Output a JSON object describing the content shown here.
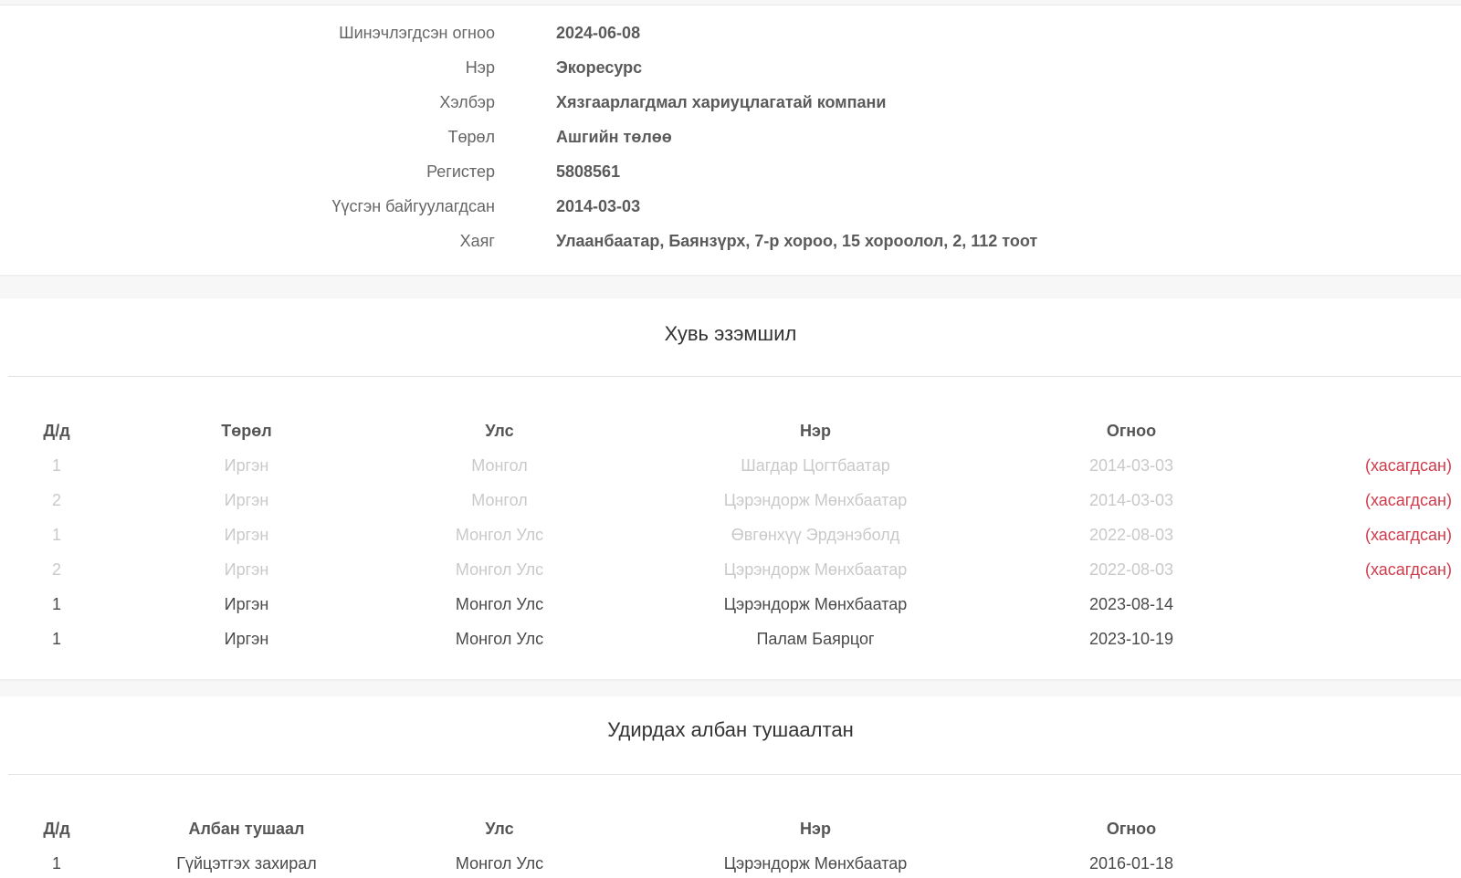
{
  "company_info": {
    "rows": [
      {
        "label": "Шинэчлэгдсэн огноо",
        "value": "2024-06-08"
      },
      {
        "label": "Нэр",
        "value": "Экоресурс"
      },
      {
        "label": "Хэлбэр",
        "value": "Хязгаарлагдмал хариуцлагатай компани"
      },
      {
        "label": "Төрөл",
        "value": "Ашгийн төлөө"
      },
      {
        "label": "Регистер",
        "value": "5808561"
      },
      {
        "label": "Үүсгэн байгуулагдсан",
        "value": "2014-03-03"
      },
      {
        "label": "Хаяг",
        "value": "Улаанбаатар, Баянзүрх, 7-р хороо, 15 хороолол, 2, 112 тоот"
      }
    ]
  },
  "ownership": {
    "title": "Хувь эзэмшил",
    "headers": [
      "Д/д",
      "Төрөл",
      "Улс",
      "Нэр",
      "Огноо"
    ],
    "rows": [
      {
        "no": "1",
        "type": "Иргэн",
        "country": "Монгол",
        "name": "Шагдар Цогтбаатар",
        "date": "2014-03-03",
        "status": "(хасагдсан)"
      },
      {
        "no": "2",
        "type": "Иргэн",
        "country": "Монгол",
        "name": "Цэрэндорж Мөнхбаатар",
        "date": "2014-03-03",
        "status": "(хасагдсан)"
      },
      {
        "no": "1",
        "type": "Иргэн",
        "country": "Монгол Улс",
        "name": "Өвгөнхүү Эрдэнэболд",
        "date": "2022-08-03",
        "status": "(хасагдсан)"
      },
      {
        "no": "2",
        "type": "Иргэн",
        "country": "Монгол Улс",
        "name": "Цэрэндорж Мөнхбаатар",
        "date": "2022-08-03",
        "status": "(хасагдсан)"
      },
      {
        "no": "1",
        "type": "Иргэн",
        "country": "Монгол Улс",
        "name": "Цэрэндорж Мөнхбаатар",
        "date": "2023-08-14",
        "status": ""
      },
      {
        "no": "1",
        "type": "Иргэн",
        "country": "Монгол Улс",
        "name": "Палам Баярцог",
        "date": "2023-10-19",
        "status": ""
      }
    ]
  },
  "officers": {
    "title": "Удирдах албан тушаалтан",
    "headers": [
      "Д/д",
      "Албан тушаал",
      "Улс",
      "Нэр",
      "Огноо"
    ],
    "rows": [
      {
        "no": "1",
        "position": "Гүйцэтгэх захирал",
        "country": "Монгол Улс",
        "name": "Цэрэндорж Мөнхбаатар",
        "date": "2016-01-18"
      }
    ]
  },
  "colors": {
    "removed_status": "#cf3b4b",
    "removed_text": "#c9c9c9",
    "active_text": "#4a4a4a"
  }
}
